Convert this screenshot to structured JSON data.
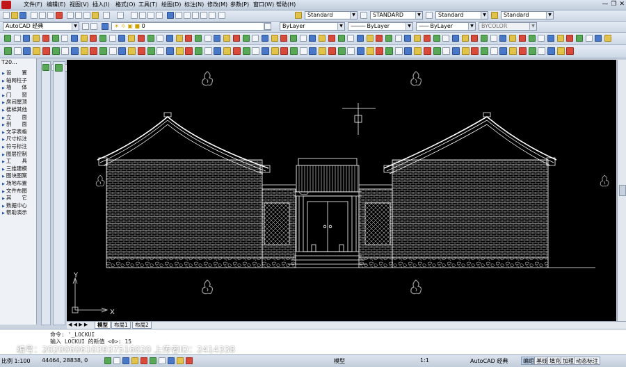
{
  "menu": {
    "items": [
      "文件(F)",
      "编辑(E)",
      "视图(V)",
      "插入(I)",
      "格式(O)",
      "工具(T)",
      "绘图(D)",
      "标注(N)",
      "修改(M)",
      "参数(P)",
      "窗口(W)",
      "帮助(H)"
    ],
    "window_controls": [
      "—",
      "❐",
      "✕"
    ]
  },
  "toolbar1": {
    "text_style_combo": "Standard",
    "dim_style_combo": "STANDARD",
    "table_style_combo": "Standard",
    "multileader_style_combo": "Standard"
  },
  "toolbar2": {
    "workspace_combo": "AutoCAD 经典",
    "layer_combo": "0",
    "color_combo": "ByLayer",
    "linetype_combo": "ByLayer",
    "lineweight_combo": "ByLayer",
    "plotstyle_combo": "BYCOLOR"
  },
  "t20": {
    "title": "T20...",
    "items": [
      "设　　置",
      "轴网柱子",
      "墙　　体",
      "门　　窗",
      "房间屋顶",
      "楼梯其他",
      "立　　面",
      "剖　　面",
      "文字表格",
      "尺寸标注",
      "符号标注",
      "图层控制",
      "工　　具",
      "三维建模",
      "图块图案",
      "场地布置",
      "文件布图",
      "其　　它",
      "数据中心",
      "帮助演示"
    ]
  },
  "canvas": {
    "ucs_x": "X",
    "ucs_y": "Y"
  },
  "layout_tabs": [
    "模型",
    "布局1",
    "布局2"
  ],
  "command": {
    "line1": "命令: '_LOCKUI",
    "line2": "输入 LOCKUI 的新值 <0>: 15"
  },
  "watermark": "编号：20200606103937516020 上传者ID：2414338",
  "status": {
    "scale": "比例 1:100",
    "coords": "44464, 28838, 0",
    "model": "模型",
    "annotation_scale": "1:1",
    "workspace": "AutoCAD 经典",
    "buttons": [
      "编组",
      "基线",
      "填充",
      "加粗",
      "动态标注"
    ]
  },
  "colors": {
    "canvas": "#000000",
    "lines": "#ffffff",
    "chrome": "#c9d3df"
  }
}
